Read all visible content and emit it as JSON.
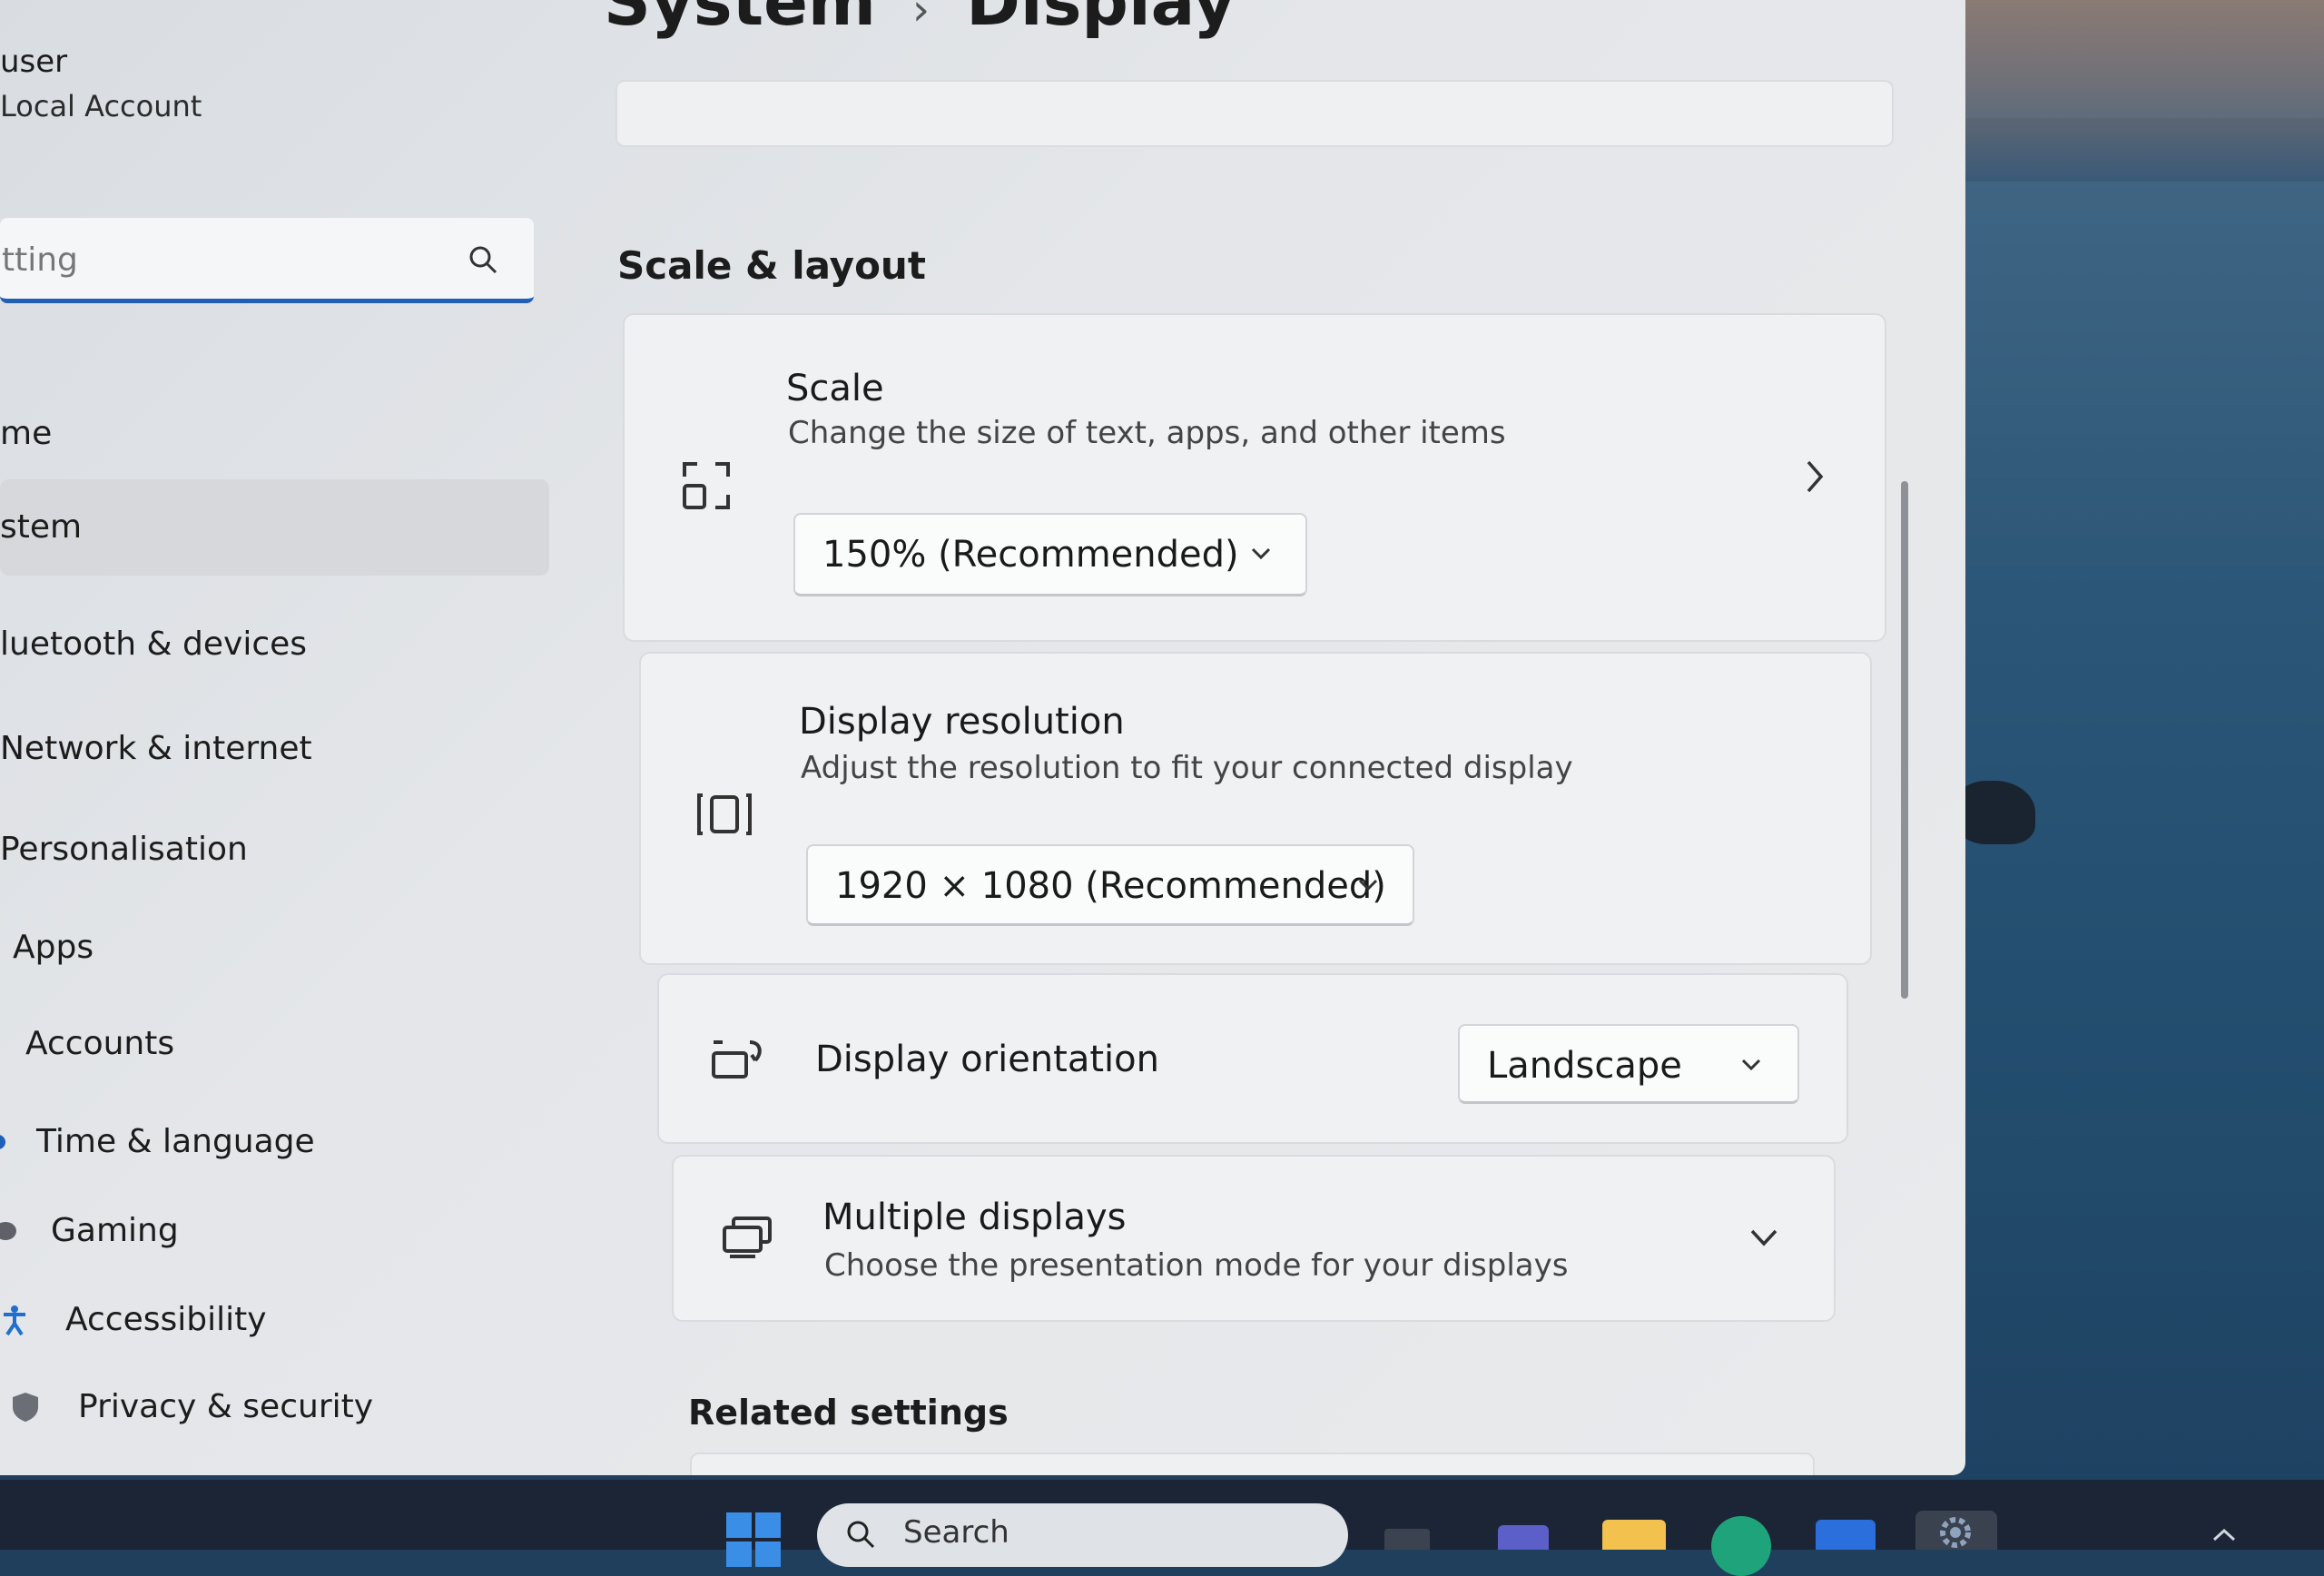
{
  "user": {
    "name": "user",
    "account_type": "Local Account"
  },
  "search": {
    "value": "tting"
  },
  "sidebar": {
    "items": [
      {
        "label": "me",
        "icon": "home-icon"
      },
      {
        "label": "stem",
        "icon": "system-icon",
        "selected": true
      },
      {
        "label": "luetooth & devices",
        "icon": "bluetooth-icon"
      },
      {
        "label": "Network & internet",
        "icon": "network-icon"
      },
      {
        "label": "Personalisation",
        "icon": "brush-icon"
      },
      {
        "label": "Apps",
        "icon": "apps-icon"
      },
      {
        "label": "Accounts",
        "icon": "person-icon"
      },
      {
        "label": "Time & language",
        "icon": "globe-icon"
      },
      {
        "label": "Gaming",
        "icon": "gamepad-icon"
      },
      {
        "label": "Accessibility",
        "icon": "accessibility-icon"
      },
      {
        "label": "Privacy & security",
        "icon": "shield-icon"
      }
    ]
  },
  "breadcrumb": {
    "parent": "System",
    "separator": "›",
    "current": "Display"
  },
  "section": {
    "title": "Scale & layout"
  },
  "scale": {
    "title": "Scale",
    "description": "Change the size of text, apps, and other items",
    "value": "150% (Recommended)"
  },
  "resolution": {
    "title": "Display resolution",
    "description": "Adjust the resolution to fit your connected display",
    "value": "1920 × 1080 (Recommended)"
  },
  "orientation": {
    "title": "Display orientation",
    "value": "Landscape"
  },
  "multiple": {
    "title": "Multiple displays",
    "description": "Choose the presentation mode for your displays"
  },
  "related": {
    "title": "Related settings"
  },
  "taskbar": {
    "search_placeholder": "Search"
  },
  "colors": {
    "accent": "#1f5fb8",
    "window_bg": "#e6e8eb",
    "taskbar": "#1b2535"
  }
}
